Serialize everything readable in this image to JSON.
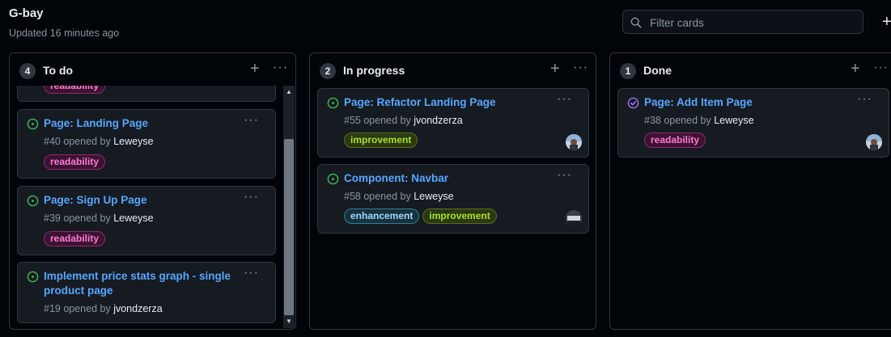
{
  "project": {
    "title": "G-bay",
    "updated": "Updated 16 minutes ago"
  },
  "filter": {
    "placeholder": "Filter cards"
  },
  "icons": {
    "search": "search-icon",
    "plus": "plus-icon",
    "kebab": "kebab-horizontal-icon",
    "open_issue": "issue-opened-icon",
    "closed_issue": "issue-closed-icon"
  },
  "colors": {
    "link": "#58a6ff",
    "open": "#3fb950",
    "closed": "#a371f7",
    "readability": "#ff7bd1",
    "improvement": "#a6e22e",
    "enhancement": "#a5d6ff"
  },
  "columns": [
    {
      "count": "4",
      "title": "To do",
      "cards": [
        {
          "label_partial": "readability"
        },
        {
          "title": "Page: Landing Page",
          "meta": "#40 opened by",
          "user": "Leweyse",
          "labels": [
            "readability"
          ]
        },
        {
          "title": "Page: Sign Up Page",
          "meta": "#39 opened by",
          "user": "Leweyse",
          "labels": [
            "readability"
          ]
        },
        {
          "title": "Implement price stats graph - single product page",
          "meta": "#19 opened by",
          "user": "jvondzerza",
          "labels": []
        }
      ]
    },
    {
      "count": "2",
      "title": "In progress",
      "cards": [
        {
          "title": "Page: Refactor Landing Page",
          "meta": "#55 opened by",
          "user": "jvondzerza",
          "labels": [
            "improvement"
          ]
        },
        {
          "title": "Component: Navbar",
          "meta": "#58 opened by",
          "user": "Leweyse",
          "labels": [
            "enhancement",
            "improvement"
          ]
        }
      ]
    },
    {
      "count": "1",
      "title": "Done",
      "cards": [
        {
          "title": "Page: Add Item Page",
          "meta": "#38 opened by",
          "user": "Leweyse",
          "labels": [
            "readability"
          ]
        }
      ]
    }
  ],
  "ui": {
    "plus": "+",
    "dots": "···",
    "up": "▲",
    "down": "▼"
  }
}
